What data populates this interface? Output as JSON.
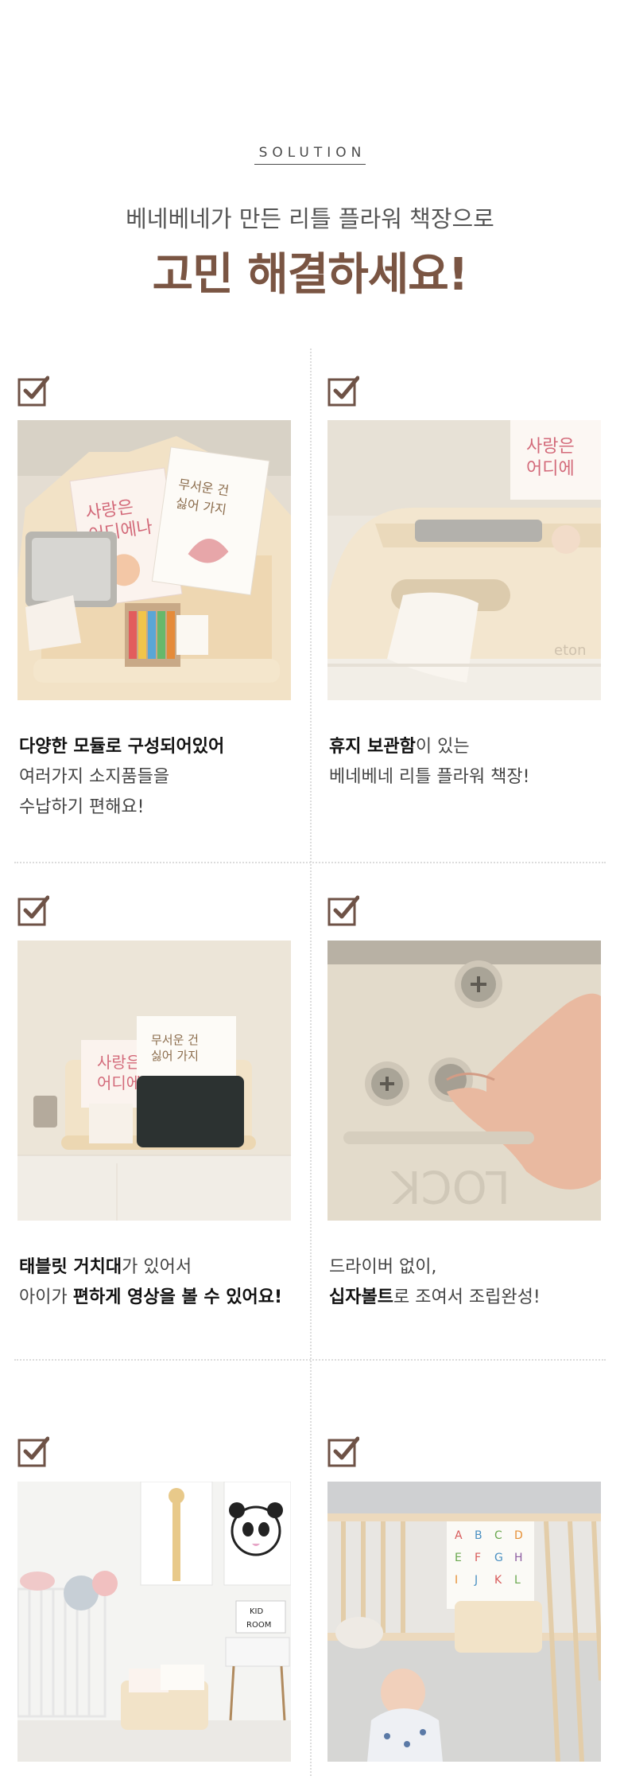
{
  "header": {
    "eyebrow": "SOLUTION",
    "subtitle": "베네베네가 만든 리틀 플라워 책장으로",
    "title": "고민 해결하세요!"
  },
  "colors": {
    "brown": "#7a5543",
    "checkbox": "#6e5246",
    "cream": "#f2e6d2"
  },
  "features": [
    {
      "line1_bold": "다양한 모듈로 구성되어있어",
      "line1_rest": "",
      "line2": "여러가지 소지품들을",
      "line3": "수납하기 편해요!"
    },
    {
      "line1_bold": "휴지 보관함",
      "line1_rest": "이 있는",
      "line2": "베네베네 리틀 플라워 책장!"
    },
    {
      "line1_bold": "태블릿 거치대",
      "line1_rest": "가 있어서",
      "line2_plain": "아이가 ",
      "line2_bold": "편하게 영상을 볼 수 있어요!"
    },
    {
      "line1": "드라이버 없이,",
      "line2_bold": "십자볼트",
      "line2_rest": "로 조여서 조립완성!"
    }
  ],
  "photo_text": {
    "book1": "사랑은 어디에나 있어",
    "book2": "무서운 건 싫어 가지",
    "lock": "LOCK",
    "kid_room_1": "KID",
    "kid_room_2": "ROOM",
    "brand": "eton"
  },
  "icons": [
    "checkbox-checked-icon"
  ]
}
